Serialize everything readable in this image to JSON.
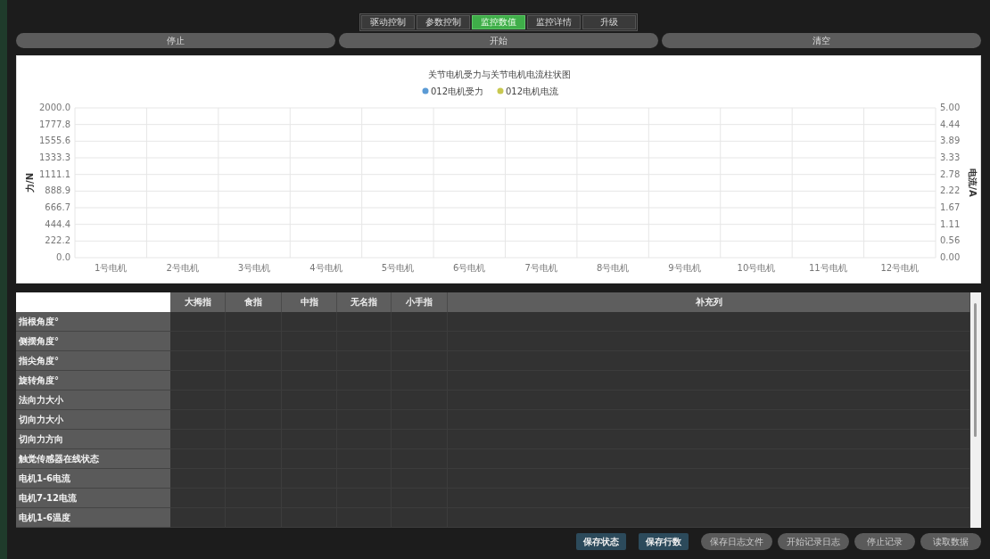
{
  "tabs": [
    {
      "label": "驱动控制",
      "selected": false
    },
    {
      "label": "参数控制",
      "selected": false
    },
    {
      "label": "监控数值",
      "selected": true
    },
    {
      "label": "监控详情",
      "selected": false
    },
    {
      "label": "升级",
      "selected": false
    }
  ],
  "controls": [
    "停止",
    "开始",
    "清空"
  ],
  "chart": {
    "chart_data": {
      "type": "bar",
      "title": "关节电机受力与关节电机电流柱状图",
      "ylabel": "力/N",
      "categories": [
        "1号电机",
        "2号电机",
        "3号电机",
        "4号电机",
        "5号电机",
        "6号电机",
        "7号电机",
        "8号电机",
        "9号电机",
        "10号电机",
        "11号电机",
        "12号电机"
      ],
      "series": [
        {
          "name": "012电机受力",
          "color": "#5b9bd5",
          "values": [
            null,
            null,
            null,
            null,
            null,
            null,
            null,
            null,
            null,
            null,
            null,
            null
          ]
        },
        {
          "name": "012电机电流",
          "color": "#c8c850",
          "values": [
            null,
            null,
            null,
            null,
            null,
            null,
            null,
            null,
            null,
            null,
            null,
            null
          ]
        }
      ],
      "ylim": [
        0,
        2000
      ],
      "grid": true,
      "yticks": [
        {
          "value": 0,
          "label": "0.0"
        },
        {
          "value": 222.2,
          "label": "222.2"
        },
        {
          "value": 444.4,
          "label": "444.4"
        },
        {
          "value": 666.7,
          "label": "666.7"
        },
        {
          "value": 888.9,
          "label": "888.9"
        },
        {
          "value": 1111.1,
          "label": "1111.1"
        },
        {
          "value": 1333.3,
          "label": "1333.3"
        },
        {
          "value": 1555.6,
          "label": "1555.6"
        },
        {
          "value": 1777.8,
          "label": "1777.8"
        },
        {
          "value": 2000,
          "label": "2000.0"
        }
      ]
    },
    "right_axis": {
      "label": "电流/A",
      "ticks": [
        "5.00",
        "4.44",
        "3.89",
        "3.33",
        "2.78",
        "2.22",
        "1.67",
        "1.11",
        "0.56",
        "0.00"
      ]
    }
  },
  "table": {
    "columns": [
      "大拇指",
      "食指",
      "中指",
      "无名指",
      "小手指",
      "补充列"
    ],
    "rows": [
      "指根角度°",
      "侧摆角度°",
      "指尖角度°",
      "旋转角度°",
      "法向力大小",
      "切向力大小",
      "切向力方向",
      "触觉传感器在线状态",
      "电机1-6电流",
      "电机7-12电流",
      "电机1-6温度"
    ]
  },
  "buttons": [
    {
      "label": "保存状态",
      "kind": "primary"
    },
    {
      "label": "保存行数",
      "kind": "primary"
    },
    {
      "label": "保存日志文件",
      "kind": "secondary"
    },
    {
      "label": "开始记录日志",
      "kind": "secondary"
    },
    {
      "label": "停止记录",
      "kind": "secondary"
    },
    {
      "label": "读取数据",
      "kind": "secondary"
    }
  ]
}
